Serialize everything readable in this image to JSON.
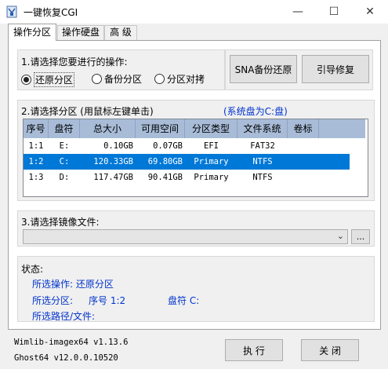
{
  "window": {
    "title": "一键恢复CGI",
    "minimize_glyph": "—",
    "maximize_glyph": "☐",
    "close_glyph": "✕"
  },
  "tabs": [
    {
      "label": "操作分区",
      "active": true
    },
    {
      "label": "操作硬盘",
      "active": false
    },
    {
      "label": "高 级",
      "active": false
    }
  ],
  "section1": {
    "label": "1.请选择您要进行的操作:",
    "options": [
      {
        "label": "还原分区",
        "selected": true
      },
      {
        "label": "备份分区",
        "selected": false
      },
      {
        "label": "分区对拷",
        "selected": false
      }
    ],
    "sna_button": "SNA备份还原",
    "boot_button": "引导修复"
  },
  "section2": {
    "label": "2.请选择分区 (用鼠标左键单击)",
    "system_disk": "(系统盘为C:盘)",
    "columns": [
      "序号",
      "盘符",
      "总大小",
      "可用空间",
      "分区类型",
      "文件系统",
      "卷标"
    ],
    "rows": [
      {
        "index": "1:1",
        "drive": "E:",
        "total": "0.10GB",
        "free": "0.07GB",
        "type": "EFI",
        "fs": "FAT32",
        "label": "",
        "selected": false
      },
      {
        "index": "1:2",
        "drive": "C:",
        "total": "120.33GB",
        "free": "69.80GB",
        "type": "Primary",
        "fs": "NTFS",
        "label": "",
        "selected": true
      },
      {
        "index": "1:3",
        "drive": "D:",
        "total": "117.47GB",
        "free": "90.41GB",
        "type": "Primary",
        "fs": "NTFS",
        "label": "",
        "selected": false
      }
    ]
  },
  "section3": {
    "label": "3.请选择镜像文件:",
    "value": "",
    "browse_label": "..."
  },
  "status": {
    "label": "状态:",
    "operation": "所选操作: 还原分区",
    "partition_label": "所选分区:",
    "index_text": "序号 1:2",
    "drive_text": "盘符 C:",
    "path": "所选路径/文件:"
  },
  "footer": {
    "version1": "Wimlib-imagex64 v1.13.6",
    "version2": "Ghost64 v12.0.0.10520",
    "execute_button": "执 行",
    "close_button": "关 闭"
  }
}
